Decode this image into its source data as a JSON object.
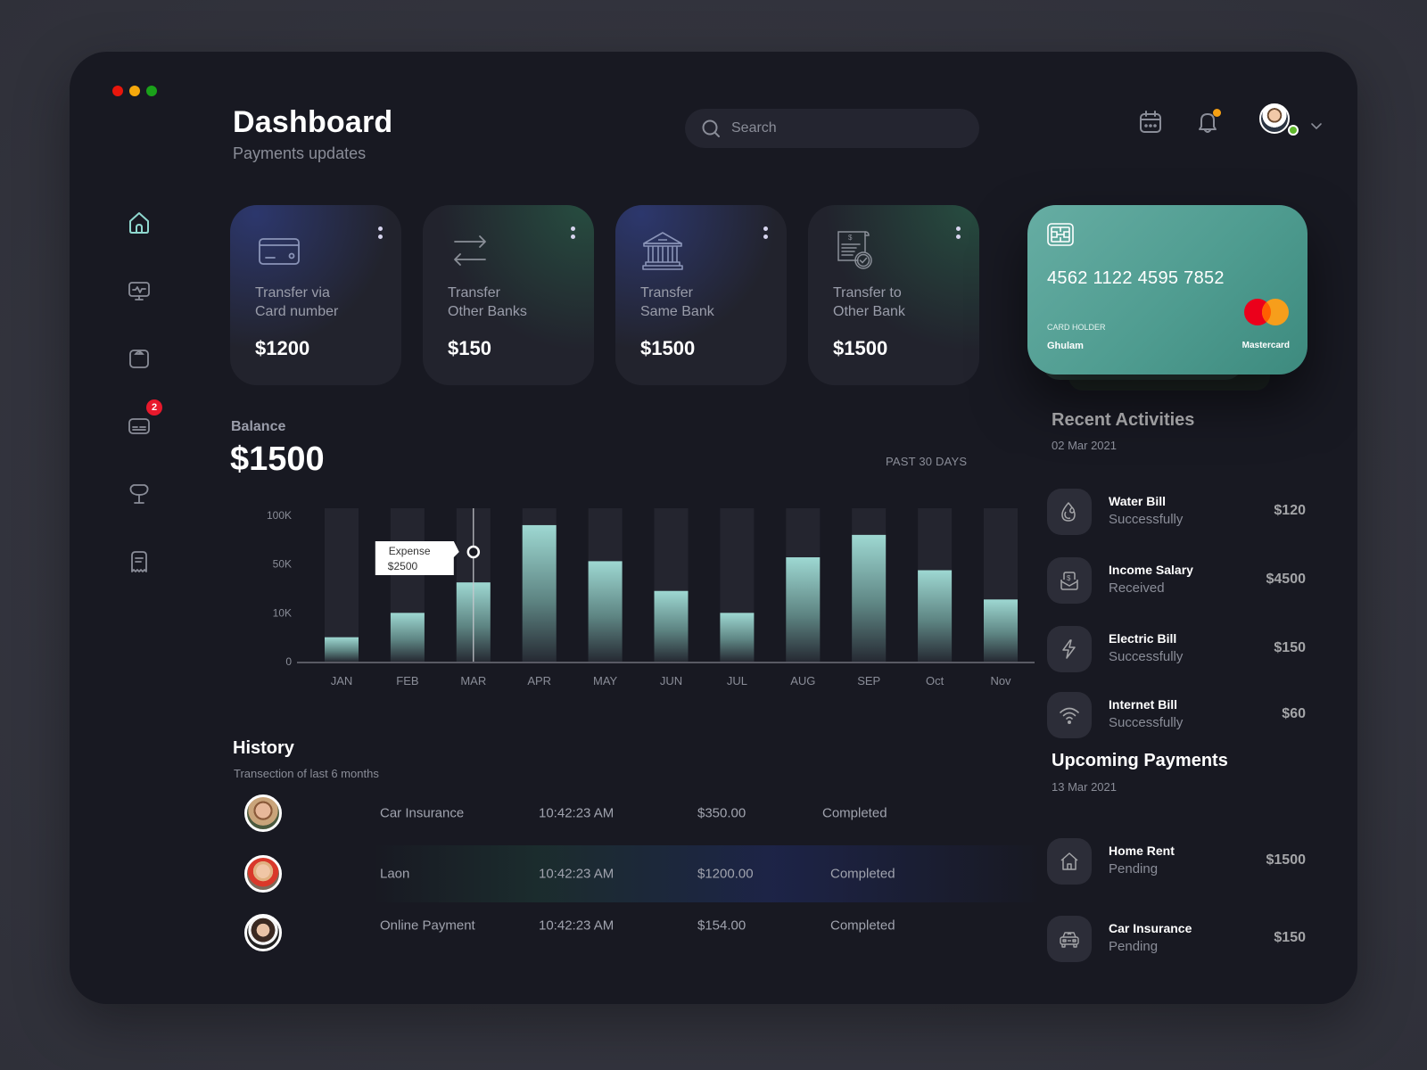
{
  "window": {
    "controls": [
      "close",
      "minimize",
      "maximize"
    ],
    "control_colors": [
      "#e8160c",
      "#f5a80c",
      "#1aa11a"
    ]
  },
  "header": {
    "title": "Dashboard",
    "subtitle": "Payments updates",
    "search": {
      "placeholder": "Search",
      "value": ""
    },
    "icons": [
      "calendar-icon",
      "bell-icon",
      "avatar",
      "chevron-down-icon"
    ],
    "notification_dot_color": "#f5a013",
    "online_status_color": "#5fb82c"
  },
  "sidebar": {
    "items": [
      {
        "icon": "home-icon",
        "active": true
      },
      {
        "icon": "monitor-activity-icon",
        "active": false
      },
      {
        "icon": "scale-icon",
        "active": false
      },
      {
        "icon": "card-message-icon",
        "active": false,
        "badge": "2"
      },
      {
        "icon": "trophy-icon",
        "active": false
      },
      {
        "icon": "receipt-icon",
        "active": false
      }
    ],
    "active_color": "#8fd8cf",
    "badge_color": "#e8192c"
  },
  "transfer_cards": [
    {
      "icon": "credit-card-icon",
      "line1": "Transfer via",
      "line2": "Card number",
      "amount": "$1200"
    },
    {
      "icon": "transfer-arrows-icon",
      "line1": "Transfer",
      "line2": "Other Banks",
      "amount": "$150"
    },
    {
      "icon": "bank-icon",
      "line1": "Transfer",
      "line2": "Same Bank",
      "amount": "$1500"
    },
    {
      "icon": "invoice-check-icon",
      "line1": "Transfer to",
      "line2": "Other Bank",
      "amount": "$1500"
    }
  ],
  "balance": {
    "label": "Balance",
    "amount": "$1500",
    "period": "PAST 30 DAYS"
  },
  "chart_data": {
    "type": "bar",
    "title": "Balance",
    "xlabel": "",
    "ylabel": "",
    "categories": [
      "JAN",
      "FEB",
      "MAR",
      "APR",
      "MAY",
      "JUN",
      "JUL",
      "AUG",
      "SEP",
      "Oct",
      "Nov"
    ],
    "values": [
      5000,
      10000,
      35000,
      90000,
      53000,
      28000,
      10000,
      57000,
      80000,
      45000,
      21000
    ],
    "y_ticks": [
      0,
      10000,
      50000,
      100000
    ],
    "y_tick_labels": [
      "0",
      "10K",
      "50K",
      "100K"
    ],
    "y_scale": "piecewise (ticks evenly spaced)",
    "ylim": [
      0,
      100000
    ],
    "grid": false,
    "bar_color": "#9ed8d2",
    "track_color": "#24252f",
    "tooltip": {
      "category": "MAR",
      "label": "Expense",
      "value": "$2500"
    }
  },
  "history": {
    "title": "History",
    "subtitle": "Transection of last 6 months",
    "rows": [
      {
        "avatar": "avatar-man-glasses",
        "name": "Car Insurance",
        "time": "10:42:23 AM",
        "amount": "$350.00",
        "status": "Completed",
        "highlighted": false
      },
      {
        "avatar": "avatar-woman-red-hood",
        "name": "Laon",
        "time": "10:42:23 AM",
        "amount": "$1200.00",
        "status": "Completed",
        "highlighted": true
      },
      {
        "avatar": "avatar-woman-dark-hair",
        "name": "Online Payment",
        "time": "10:42:23 AM",
        "amount": "$154.00",
        "status": "Completed",
        "highlighted": false
      }
    ]
  },
  "credit_card": {
    "number": "4562 1122 4595 7852",
    "holder_label": "CARD HOLDER",
    "holder_name": "Ghulam",
    "brand": "Mastercard",
    "color": "#56a398"
  },
  "recent_activities": {
    "title": "Recent Activities",
    "date": "02 Mar 2021",
    "items": [
      {
        "icon": "water-drop-icon",
        "name": "Water Bill",
        "status": "Successfully",
        "amount": "$120"
      },
      {
        "icon": "salary-envelope-icon",
        "name": "Income Salary",
        "status": "Received",
        "amount": "$4500"
      },
      {
        "icon": "lightning-icon",
        "name": "Electric Bill",
        "status": "Successfully",
        "amount": "$150"
      },
      {
        "icon": "wifi-icon",
        "name": "Internet Bill",
        "status": "Successfully",
        "amount": "$60"
      }
    ]
  },
  "upcoming_payments": {
    "title": "Upcoming Payments",
    "date": "13 Mar 2021",
    "items": [
      {
        "icon": "house-icon",
        "name": "Home Rent",
        "status": "Pending",
        "amount": "$1500"
      },
      {
        "icon": "car-icon",
        "name": "Car Insurance",
        "status": "Pending",
        "amount": "$150"
      }
    ]
  }
}
